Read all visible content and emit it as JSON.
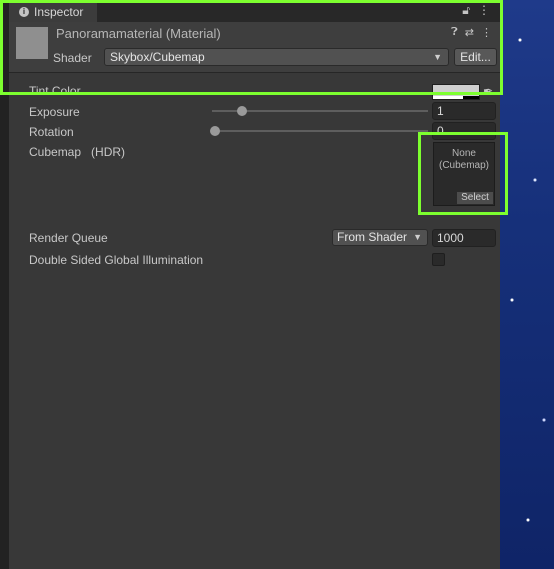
{
  "window": {
    "tab_label": "Inspector"
  },
  "header": {
    "material_name": "Panoramamaterial (Material)",
    "shader_label": "Shader",
    "shader_value": "Skybox/Cubemap",
    "edit_button": "Edit..."
  },
  "properties": {
    "tint_color": {
      "label": "Tint Color"
    },
    "exposure": {
      "label": "Exposure",
      "value": "1",
      "slider_fraction": 0.14
    },
    "rotation": {
      "label": "Rotation",
      "value": "0",
      "slider_fraction": 0.0
    },
    "cubemap": {
      "label": "Cubemap",
      "hdr_label": "(HDR)",
      "slot_line1": "None",
      "slot_line2": "(Cubemap)",
      "select_button": "Select"
    }
  },
  "render_queue": {
    "label": "Render Queue",
    "dropdown_value": "From Shader",
    "value": "1000"
  },
  "double_sided_gi": {
    "label": "Double Sided Global Illumination",
    "checked": false
  },
  "icons": {
    "info": "info-icon",
    "lock": "lock-icon",
    "menu": "kebab-menu-icon",
    "help": "help-icon",
    "preset": "preset-sliders-icon",
    "eyedropper": "eyedropper-icon",
    "dropdown": "chevron-down-icon"
  },
  "colors": {
    "highlight": "#7dff2f",
    "panel": "#383838",
    "tab_accent": "#3a79bb"
  }
}
